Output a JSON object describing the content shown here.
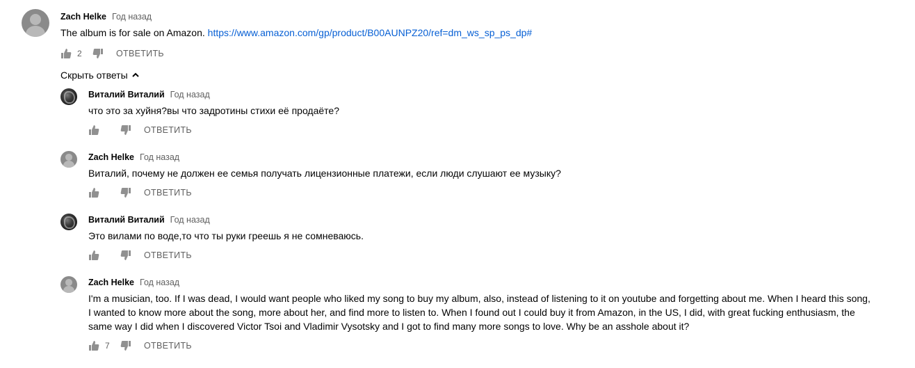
{
  "colors": {
    "link": "#065fd4",
    "meta": "#606060",
    "icon": "#909090",
    "text": "#030303"
  },
  "top_comment": {
    "author": "Zach Helke",
    "time": "Год назад",
    "text": "The album is for sale on Amazon. ",
    "link": "https://www.amazon.com/gp/product/B00AUNPZ20/ref=dm_ws_sp_ps_dp#",
    "likes": "2",
    "reply_label": "ОТВЕТИТЬ",
    "avatar_icon": "avatar-placeholder-icon"
  },
  "hide_replies_label": "Скрыть ответы",
  "replies": [
    {
      "author": "Виталий Виталий",
      "time": "Год назад",
      "text": "что это за хуйня?вы что задротины стихи её продаёте?",
      "likes": "",
      "reply_label": "ОТВЕТИТЬ",
      "avatar_icon": "avatar-photo-icon"
    },
    {
      "author": "Zach Helke",
      "time": "Год назад",
      "text": "Виталий, почему не должен ее семья получать лицензионные платежи, если люди слушают ее музыку?",
      "likes": "",
      "reply_label": "ОТВЕТИТЬ",
      "avatar_icon": "avatar-placeholder-icon"
    },
    {
      "author": "Виталий Виталий",
      "time": "Год назад",
      "text": "Это вилами по воде,то что ты руки греешь я не сомневаюсь.",
      "likes": "",
      "reply_label": "ОТВЕТИТЬ",
      "avatar_icon": "avatar-photo-icon"
    },
    {
      "author": "Zach Helke",
      "time": "Год назад",
      "text": "I'm a musician, too. If I was dead, I would want people who liked my song to buy my album, also, instead of listening to it on youtube and forgetting about me. When I heard this song, I wanted to know more about the song, more about her, and find more to listen to. When I found out I could buy it from Amazon, in the US, I did, with great fucking enthusiasm, the same way I did when I discovered Victor Tsoi and Vladimir Vysotsky and I got to find many more songs to love. Why be an asshole about it?",
      "likes": "7",
      "reply_label": "ОТВЕТИТЬ",
      "avatar_icon": "avatar-placeholder-icon"
    }
  ]
}
